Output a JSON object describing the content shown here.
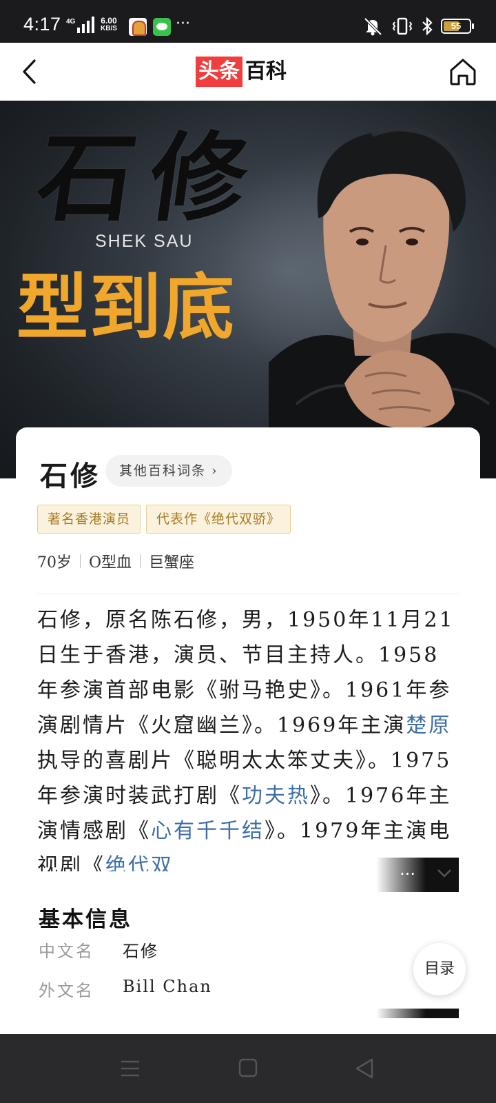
{
  "status_bar": {
    "time": "4:17",
    "network": "4G",
    "speed_value": "6.00",
    "speed_unit": "KB/S",
    "more": "···",
    "battery": "55",
    "battery_level": 0.55,
    "icons": [
      "signal-icon",
      "app-notification-icon",
      "line-icon",
      "mute-icon",
      "vibrate-icon",
      "bluetooth-icon",
      "battery-icon"
    ]
  },
  "header": {
    "logo_red": "头条",
    "logo_black": "百科",
    "back_icon": "back-arrow-icon",
    "home_icon": "home-icon"
  },
  "hero": {
    "title": "石修",
    "subtitle_en": "SHEK SAU",
    "slogan": "型到底"
  },
  "entry": {
    "name": "石修",
    "other_entries_label": "其他百科词条 ›",
    "tags": [
      "著名香港演员",
      "代表作《绝代双骄》"
    ],
    "age": "70岁",
    "blood_type": "O型血",
    "zodiac": "巨蟹座",
    "summary": {
      "p1": "石修，原名陈石修，男，1950年11月21日生于香港，演员、节目主持人。1958年参演首部电影《驸马艳史》。1961年参演剧情片《火窟幽兰》。1969年主演",
      "link1": "楚原",
      "p2": "执导的喜剧片《聪明太太笨丈夫》。1975年参演时装武打剧《",
      "link2": "功夫热",
      "p3": "》。1976年主演情感剧《",
      "link3": "心有千千结",
      "p4": "》。1979年主演电视剧《",
      "link4": "绝代双",
      "ellipsis": "..."
    }
  },
  "basic_info": {
    "title": "基本信息",
    "rows": [
      {
        "key": "中文名",
        "value": "石修"
      },
      {
        "key": "外文名",
        "value": "Bill Chan"
      }
    ]
  },
  "toc_label": "目录",
  "colors": {
    "logo_red": "#f03d3d",
    "slogan": "#f0a72b",
    "link": "#3d6ea8",
    "tag_bg": "#fbf2dd",
    "tag_text": "#a87a22"
  }
}
